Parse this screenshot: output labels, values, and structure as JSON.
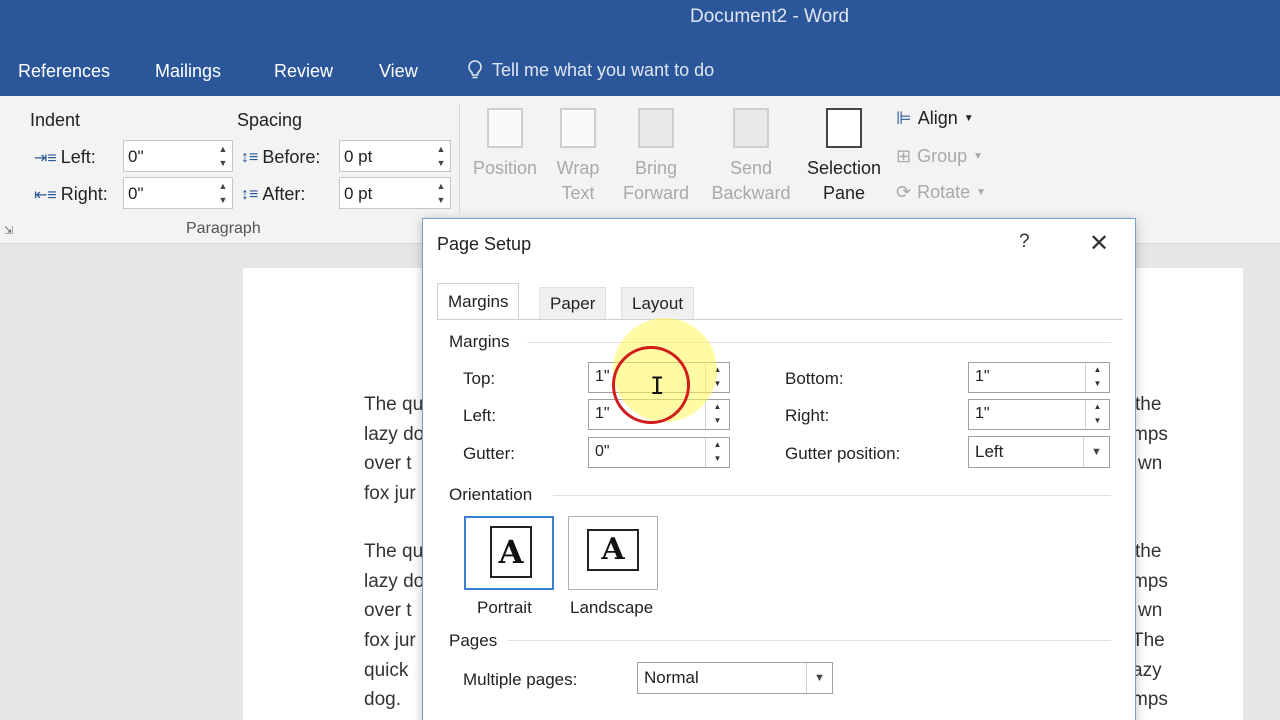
{
  "window": {
    "title": "Document2  -  Word"
  },
  "ribbon_tabs": [
    "References",
    "Mailings",
    "Review",
    "View"
  ],
  "tell_me": {
    "text": "Tell me what you want to do",
    "icon": "lightbulb-icon"
  },
  "ribbon": {
    "indent_label": "Indent",
    "spacing_label": "Spacing",
    "left_label": "Left:",
    "right_label": "Right:",
    "left_value": "0\"",
    "right_value": "0\"",
    "before_label": "Before:",
    "after_label": "After:",
    "before_value": "0 pt",
    "after_value": "0 pt",
    "paragraph_group": "Paragraph",
    "position": "Position",
    "wrap_text_1": "Wrap",
    "wrap_text_2": "Text",
    "bring_forward_1": "Bring",
    "bring_forward_2": "Forward",
    "send_backward_1": "Send",
    "send_backward_2": "Backward",
    "selection_pane_1": "Selection",
    "selection_pane_2": "Pane",
    "align": "Align",
    "group": "Group",
    "rotate": "Rotate"
  },
  "document": {
    "lines": [
      {
        "left": "The qu",
        "right": "the"
      },
      {
        "left": "lazy do",
        "right": "mps"
      },
      {
        "left": "over t",
        "right": "wn"
      },
      {
        "left": "fox jur",
        "right": ""
      },
      {
        "left": "The qu",
        "right": "the"
      },
      {
        "left": "lazy do",
        "right": "mps"
      },
      {
        "left": "over t",
        "right": "wn"
      },
      {
        "left": "fox jur",
        "right": "The"
      },
      {
        "left": "quick",
        "right": "azy"
      },
      {
        "left": "dog.",
        "right": "mps"
      }
    ]
  },
  "dialog": {
    "title": "Page Setup",
    "help": "?",
    "close": "✕",
    "tabs": [
      "Margins",
      "Paper",
      "Layout"
    ],
    "margins_section": "Margins",
    "top_label": "Top:",
    "top_value": "1\"",
    "left_label": "Left:",
    "left_value": "1\"",
    "gutter_label": "Gutter:",
    "gutter_value": "0\"",
    "bottom_label": "Bottom:",
    "bottom_value": "1\"",
    "right_label": "Right:",
    "right_value": "1\"",
    "gutter_position_label": "Gutter position:",
    "gutter_position_value": "Left",
    "orientation_section": "Orientation",
    "portrait": "Portrait",
    "landscape": "Landscape",
    "orientation_glyph": "A",
    "pages_section": "Pages",
    "multiple_pages_label": "Multiple pages:",
    "multiple_pages_value": "Normal"
  }
}
